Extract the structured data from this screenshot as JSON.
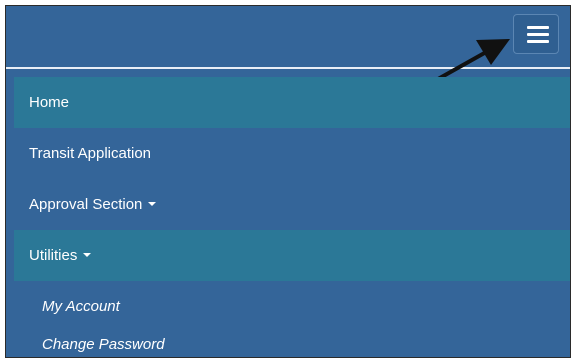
{
  "navbar": {
    "toggle_icon": "hamburger-icon",
    "annotation_icon": "arrow-icon",
    "colors": {
      "background": "#346599",
      "highlight": "#2b7897",
      "text": "#ffffff"
    }
  },
  "menu": {
    "items": [
      {
        "label": "Home",
        "highlighted": true
      },
      {
        "label": "Transit Application",
        "highlighted": false
      },
      {
        "label": "Approval Section",
        "highlighted": false,
        "dropdown": true
      },
      {
        "label": "Utilities",
        "highlighted": true,
        "dropdown": true,
        "expanded": true
      }
    ],
    "submenu": [
      {
        "label": "My Account"
      },
      {
        "label": "Change Password"
      }
    ]
  }
}
